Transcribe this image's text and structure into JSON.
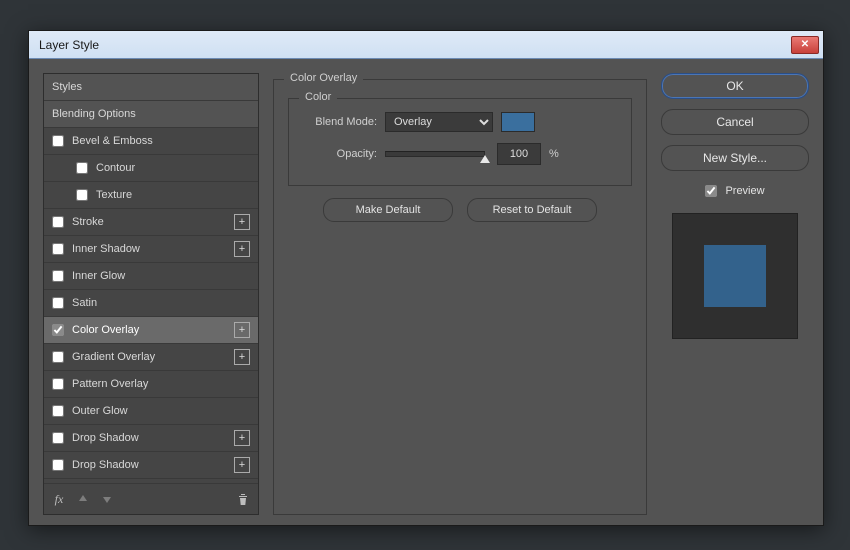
{
  "dialog": {
    "title": "Layer Style"
  },
  "styles": {
    "header_styles": "Styles",
    "header_blending": "Blending Options",
    "items": [
      {
        "label": "Bevel & Emboss",
        "checked": false,
        "sub": false,
        "plus": false
      },
      {
        "label": "Contour",
        "checked": false,
        "sub": true,
        "plus": false
      },
      {
        "label": "Texture",
        "checked": false,
        "sub": true,
        "plus": false
      },
      {
        "label": "Stroke",
        "checked": false,
        "sub": false,
        "plus": true
      },
      {
        "label": "Inner Shadow",
        "checked": false,
        "sub": false,
        "plus": true
      },
      {
        "label": "Inner Glow",
        "checked": false,
        "sub": false,
        "plus": false
      },
      {
        "label": "Satin",
        "checked": false,
        "sub": false,
        "plus": false
      },
      {
        "label": "Color Overlay",
        "checked": true,
        "sub": false,
        "plus": true,
        "selected": true
      },
      {
        "label": "Gradient Overlay",
        "checked": false,
        "sub": false,
        "plus": true
      },
      {
        "label": "Pattern Overlay",
        "checked": false,
        "sub": false,
        "plus": false
      },
      {
        "label": "Outer Glow",
        "checked": false,
        "sub": false,
        "plus": false
      },
      {
        "label": "Drop Shadow",
        "checked": false,
        "sub": false,
        "plus": true
      },
      {
        "label": "Drop Shadow",
        "checked": false,
        "sub": false,
        "plus": true
      }
    ]
  },
  "detail": {
    "group_title": "Color Overlay",
    "color_group_title": "Color",
    "blend_mode_label": "Blend Mode:",
    "blend_mode_value": "Overlay",
    "opacity_label": "Opacity:",
    "opacity_value": "100",
    "opacity_unit": "%",
    "swatch_color": "#3a6f9e",
    "make_default": "Make Default",
    "reset_default": "Reset to Default"
  },
  "right": {
    "ok": "OK",
    "cancel": "Cancel",
    "new_style": "New Style...",
    "preview_label": "Preview",
    "preview_checked": true,
    "preview_color": "#33628c"
  }
}
